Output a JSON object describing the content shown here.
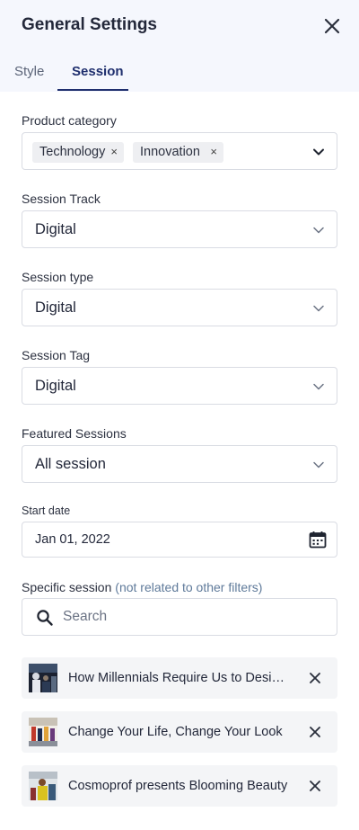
{
  "header": {
    "title": "General Settings",
    "close_icon": "close-icon"
  },
  "tabs": [
    {
      "label": "Style",
      "active": false
    },
    {
      "label": "Session",
      "active": true
    }
  ],
  "product_category": {
    "label": "Product category",
    "chips": [
      "Technology",
      "Innovation"
    ],
    "chip_remove_glyph": "×"
  },
  "session_track": {
    "label": "Session Track",
    "value": "Digital"
  },
  "session_type": {
    "label": "Session type",
    "value": "Digital"
  },
  "session_tag": {
    "label": "Session Tag",
    "value": "Digital"
  },
  "featured_sessions": {
    "label": "Featured Sessions",
    "value": "All session"
  },
  "start_date": {
    "label": "Start date",
    "value": "Jan 01, 2022",
    "icon": "calendar-icon"
  },
  "specific_session": {
    "label": "Specific session",
    "hint": "(not related to other filters)",
    "search_placeholder": "Search",
    "items": [
      {
        "name": "How Millennials Require Us to Design…"
      },
      {
        "name": "Change Your Life, Change Your Look"
      },
      {
        "name": "Cosmoprof presents Blooming Beauty"
      }
    ]
  },
  "colors": {
    "accent": "#1f2f6e",
    "header_bg": "#f5f7fd",
    "hint": "#5f7a9a",
    "item_bg": "#f4f5f7"
  }
}
